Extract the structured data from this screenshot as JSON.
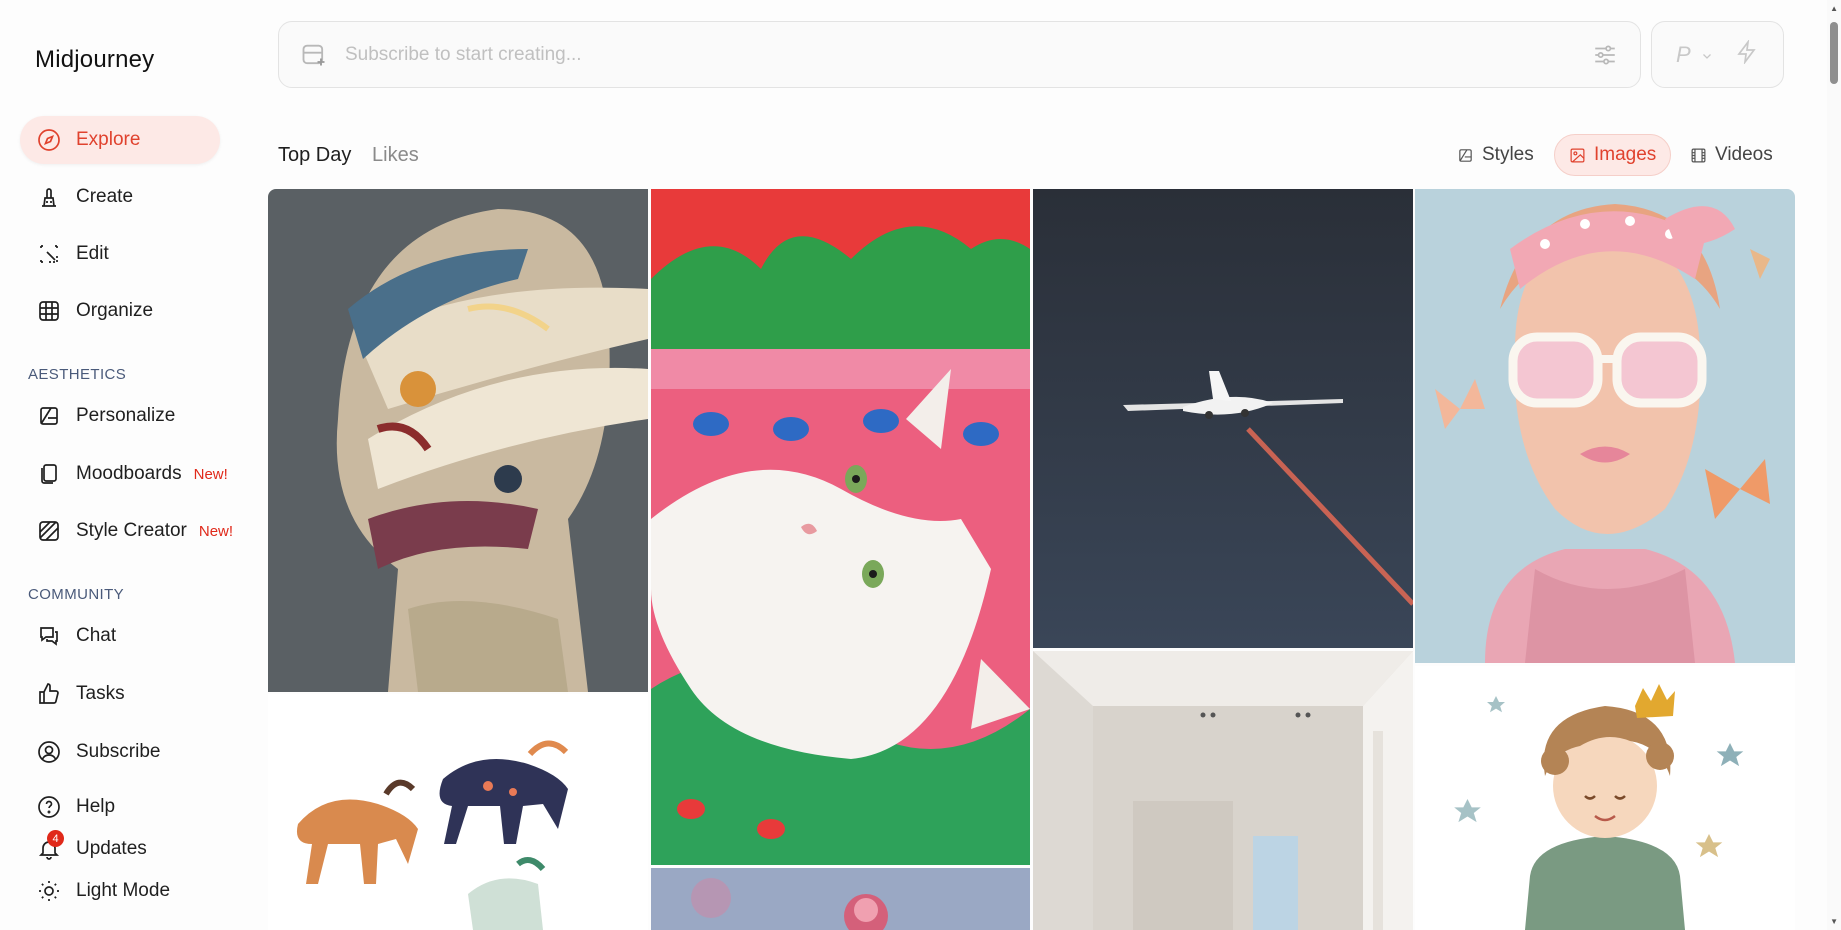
{
  "app": {
    "title": "Midjourney"
  },
  "sidebar": {
    "items": [
      {
        "label": "Explore",
        "icon": "compass-icon",
        "active": true
      },
      {
        "label": "Create",
        "icon": "brush-icon"
      },
      {
        "label": "Edit",
        "icon": "edit-frame-icon"
      },
      {
        "label": "Organize",
        "icon": "grid-icon"
      }
    ],
    "aesthetics_label": "AESTHETICS",
    "aesthetics_items": [
      {
        "label": "Personalize",
        "icon": "personalize-icon"
      },
      {
        "label": "Moodboards",
        "icon": "moodboards-icon",
        "badge": "New!"
      },
      {
        "label": "Style Creator",
        "icon": "style-creator-icon",
        "badge": "New!"
      }
    ],
    "community_label": "COMMUNITY",
    "community_items": [
      {
        "label": "Chat",
        "icon": "chat-icon"
      },
      {
        "label": "Tasks",
        "icon": "thumbs-up-icon"
      },
      {
        "label": "Subscribe",
        "icon": "user-circle-icon"
      }
    ],
    "footer_items": [
      {
        "label": "Help",
        "icon": "help-icon"
      },
      {
        "label": "Updates",
        "icon": "bell-icon",
        "badge": "4"
      },
      {
        "label": "Light Mode",
        "icon": "sun-icon"
      }
    ]
  },
  "prompt": {
    "placeholder": "Subscribe to start creating..."
  },
  "mode": {
    "letter": "P"
  },
  "tabs": {
    "top": "Top Day",
    "likes": "Likes"
  },
  "view_tabs": [
    {
      "label": "Styles",
      "icon": "styles-icon"
    },
    {
      "label": "Images",
      "icon": "image-icon",
      "active": true
    },
    {
      "label": "Videos",
      "icon": "film-icon"
    }
  ],
  "colors": {
    "accent": "#e0422e",
    "accent_bg": "#fde9e6",
    "badge": "#e0291a"
  }
}
